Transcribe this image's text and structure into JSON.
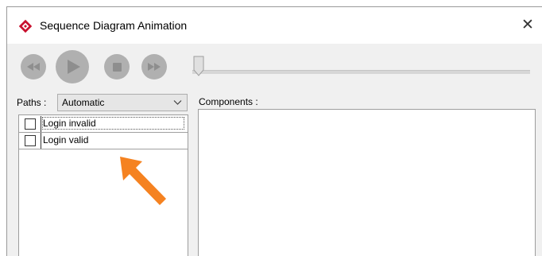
{
  "window": {
    "title": "Sequence Diagram Animation",
    "close_glyph": "✕"
  },
  "toolbar": {
    "buttons": [
      {
        "name": "rewind",
        "icon": "rewind-icon"
      },
      {
        "name": "play",
        "icon": "play-icon"
      },
      {
        "name": "stop",
        "icon": "stop-icon"
      },
      {
        "name": "fast-forward",
        "icon": "fast-forward-icon"
      }
    ],
    "slider_progress": 0
  },
  "paths": {
    "label": "Paths :",
    "selected": "Automatic",
    "items": [
      {
        "label": "Login invalid",
        "checked": false
      },
      {
        "label": "Login valid",
        "checked": false
      }
    ]
  },
  "components": {
    "label": "Components :"
  },
  "colors": {
    "annotation_arrow": "#f58220",
    "app_icon": "#c8102e",
    "button_disabled": "#b0b0b0"
  }
}
